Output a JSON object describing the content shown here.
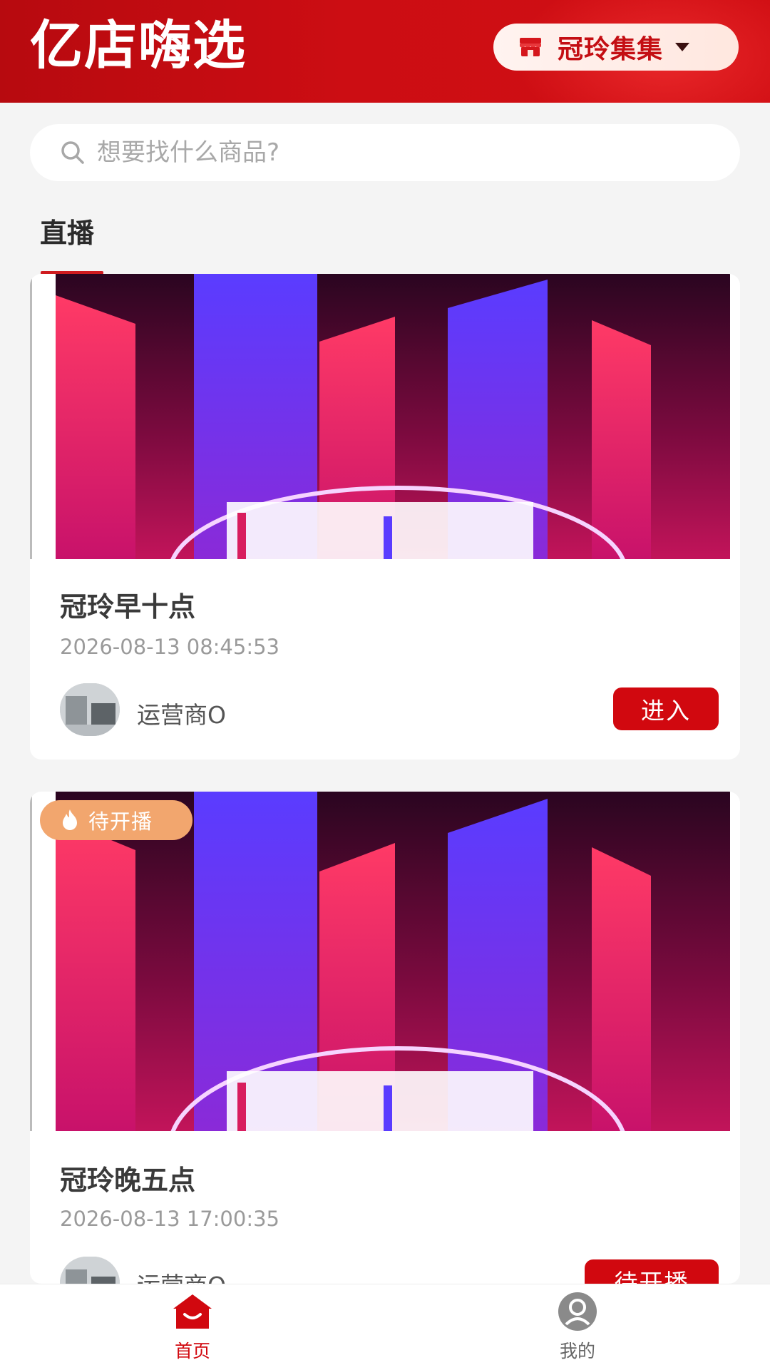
{
  "header": {
    "logo_text": "亿店嗨选",
    "store_name": "冠玲集集",
    "store_icon": "store-icon",
    "brand_color": "#cc0d13"
  },
  "search": {
    "placeholder": "想要找什么商品?",
    "icon": "search-icon"
  },
  "tabs": [
    {
      "label": "直播",
      "active": true
    }
  ],
  "live_list": [
    {
      "title": "冠玲早十点",
      "time": "2026-08-13 08:45:53",
      "owner": "运营商O",
      "action_label": "进入",
      "badge": null
    },
    {
      "title": "冠玲晚五点",
      "time": "2026-08-13 17:00:35",
      "owner": "运营商O",
      "action_label": "待开播",
      "badge": "待开播",
      "badge_icon": "flame-icon"
    }
  ],
  "bottom_nav": [
    {
      "label": "首页",
      "icon": "home-icon",
      "active": true,
      "color": "#d1080f"
    },
    {
      "label": "我的",
      "icon": "user-icon",
      "active": false,
      "color": "#666666"
    }
  ]
}
